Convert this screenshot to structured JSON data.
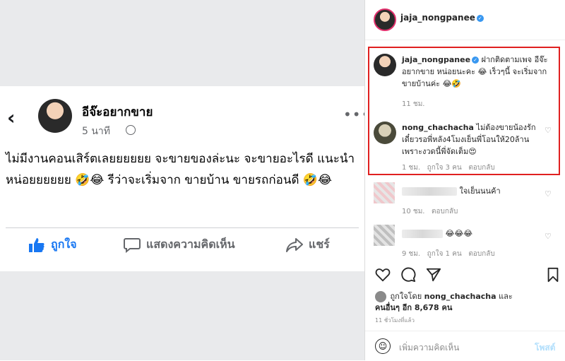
{
  "facebook": {
    "author": "อีจ๊ะอยากขาย",
    "time": "5 นาที",
    "post_text": "ไม่มีงานคอนเสิร์ตเลยยยยยย จะขายของล่ะนะ จะขายอะไรดี แนะนำหน่อยยยยยย 🤣😂 รีว่าจะเริ่มจาก ขายบ้าน ขายรถก่อนดี 🤣😂",
    "like_label": "ถูกใจ",
    "comment_label": "แสดงความคิดเห็น",
    "share_label": "แชร์"
  },
  "instagram": {
    "header_username": "jaja_nongpanee",
    "caption": {
      "username": "jaja_nongpanee",
      "text": "ฝากติดตามเพจ อีจ๊ะอยากขาย หน่อยนะคะ 😂 เร็วๆนี้ จะเริ่มจากขายบ้านค่ะ 😂🤣",
      "time": "11 ชม."
    },
    "comments": [
      {
        "username": "nong_chachacha",
        "text": "ไม่ต้องขายน้องรักเดี๋ยวรอพี่หลัง4โมงเย็นพี่โอนให้20ล้านเพราะงวดนี้พี่จัดเต็ม😍",
        "time": "1 ชม.",
        "likes": "ถูกใจ 3 คน",
        "reply": "ตอบกลับ"
      },
      {
        "text": "ใจเย็นนนค้า",
        "time": "10 ชม.",
        "reply": "ตอบกลับ"
      },
      {
        "text": "😂😂😂",
        "time": "9 ชม.",
        "likes": "ถูกใจ 1 คน",
        "reply": "ตอบกลับ"
      }
    ],
    "liked_by_prefix": "ถูกใจโดย",
    "liked_by_user": "nong_chachacha",
    "liked_by_and": "และ",
    "liked_by_others": "คนอื่นๆ อีก 8,678 คน",
    "post_time": "11 ชั่วโมงที่แล้ว",
    "comment_placeholder": "เพิ่มความคิดเห็น",
    "post_button": "โพสต์"
  }
}
